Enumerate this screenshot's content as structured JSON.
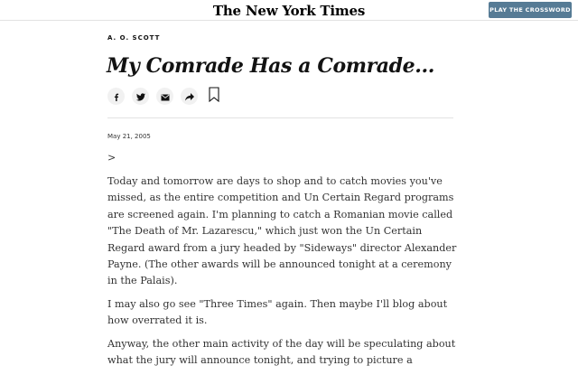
{
  "header": {
    "logo": "The New York Times",
    "cta_label": "PLAY THE CROSSWORD"
  },
  "article": {
    "byline": "A. O. SCOTT",
    "headline": "My Comrade Has a Comrade...",
    "date": "May 21, 2005",
    "marker": ">",
    "paragraphs": [
      "Today and tomorrow are days to shop and to catch movies you've missed, as the entire competition and Un Certain Regard programs are screened again. I'm planning to catch a Romanian movie called \"The Death of Mr. Lazarescu,\" which just won the Un Certain Regard award from a jury headed by \"Sideways\" director Alexander Payne. (The other awards will be announced tonight at a ceremony in the Palais).",
      "I may also go see \"Three Times\" again. Then maybe I'll blog about how overrated it is.",
      "Anyway, the other main activity of the day will be speculating about what the jury will announce tonight, and trying to picture a"
    ]
  },
  "share": {
    "icons": [
      "facebook-icon",
      "twitter-icon",
      "email-icon",
      "share-arrow-icon",
      "bookmark-icon"
    ]
  }
}
